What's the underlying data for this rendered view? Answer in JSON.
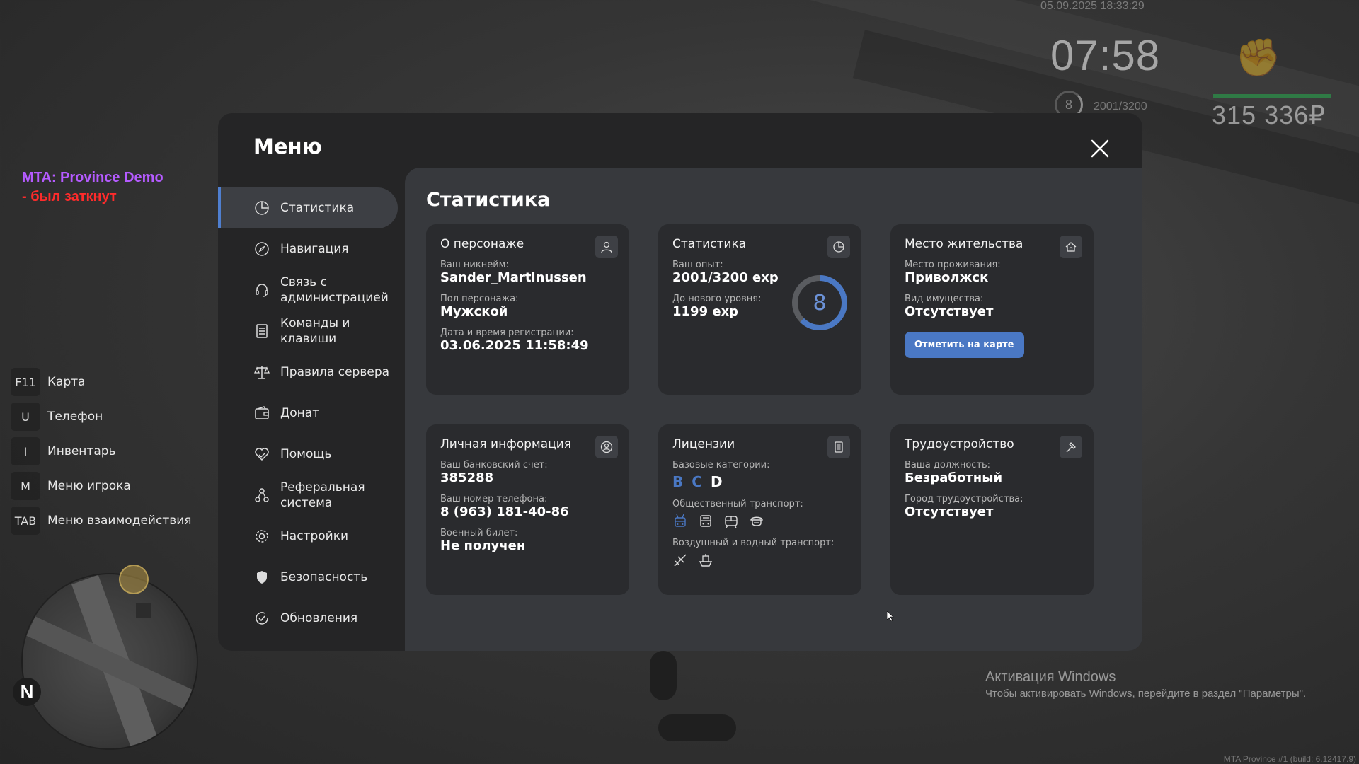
{
  "hud": {
    "datetime": "05.09.2025 18:33:29",
    "clock": "07:58",
    "level": "8",
    "exp": "2001/3200",
    "money": "315 336₽",
    "health": 1.0
  },
  "server": {
    "name": "MTA: Province Demo",
    "status": "- был заткнут"
  },
  "hotkeys": [
    {
      "key": "F11",
      "label": "Карта"
    },
    {
      "key": "U",
      "label": "Телефон"
    },
    {
      "key": "I",
      "label": "Инвентарь"
    },
    {
      "key": "M",
      "label": "Меню игрока"
    },
    {
      "key": "TAB",
      "label": "Меню взаимодействия"
    }
  ],
  "minimap": {
    "north": "N"
  },
  "windows": {
    "title": "Активация Windows",
    "subtitle": "Чтобы активировать Windows, перейдите в раздел \"Параметры\"."
  },
  "build": "MTA Province #1 (build: 6.12417.9)",
  "menu": {
    "title": "Меню",
    "sidebar": [
      {
        "label": "Статистика",
        "icon": "pie-chart-icon"
      },
      {
        "label": "Навигация",
        "icon": "compass-icon"
      },
      {
        "label": "Связь с администрацией",
        "icon": "headset-icon"
      },
      {
        "label": "Команды и клавиши",
        "icon": "list-icon"
      },
      {
        "label": "Правила сервера",
        "icon": "scales-icon"
      },
      {
        "label": "Донат",
        "icon": "wallet-icon"
      },
      {
        "label": "Помощь",
        "icon": "heart-hand-icon"
      },
      {
        "label": "Реферальная система",
        "icon": "referral-icon"
      },
      {
        "label": "Настройки",
        "icon": "gear-icon"
      },
      {
        "label": "Безопасность",
        "icon": "shield-icon"
      },
      {
        "label": "Обновления",
        "icon": "refresh-icon"
      }
    ],
    "content_title": "Статистика",
    "cards": {
      "character": {
        "title": "О персонаже",
        "nick_label": "Ваш никнейм:",
        "nick": "Sander_Martinussen",
        "gender_label": "Пол персонажа:",
        "gender": "Мужской",
        "reg_label": "Дата и время регистрации:",
        "reg": "03.06.2025 11:58:49"
      },
      "stats": {
        "title": "Статистика",
        "exp_label": "Ваш опыт:",
        "exp": "2001/3200 exp",
        "next_label": "До нового уровня:",
        "next": "1199 exp",
        "level": "8",
        "progress": 0.625
      },
      "residence": {
        "title": "Место жительства",
        "place_label": "Место проживания:",
        "place": "Приволжск",
        "property_label": "Вид имущества:",
        "property": "Отсутствует",
        "button": "Отметить на карте"
      },
      "personal": {
        "title": "Личная информация",
        "bank_label": "Ваш банковский счет:",
        "bank": "385288",
        "phone_label": "Ваш номер телефона:",
        "phone": "8 (963) 181-40-86",
        "military_label": "Военный билет:",
        "military": "Не получен"
      },
      "licenses": {
        "title": "Лицензии",
        "base_label": "Базовые категории:",
        "cats": [
          "B",
          "C",
          "D"
        ],
        "public_label": "Общественный транспорт:",
        "air_label": "Воздушный и водный транспорт:"
      },
      "job": {
        "title": "Трудоустройство",
        "position_label": "Ваша должность:",
        "position": "Безработный",
        "city_label": "Город трудоустройства:",
        "city": "Отсутствует"
      }
    }
  },
  "colors": {
    "accent": "#4a78c4",
    "panel": "#252526",
    "content": "#37393d",
    "card": "#2a2b2e"
  }
}
